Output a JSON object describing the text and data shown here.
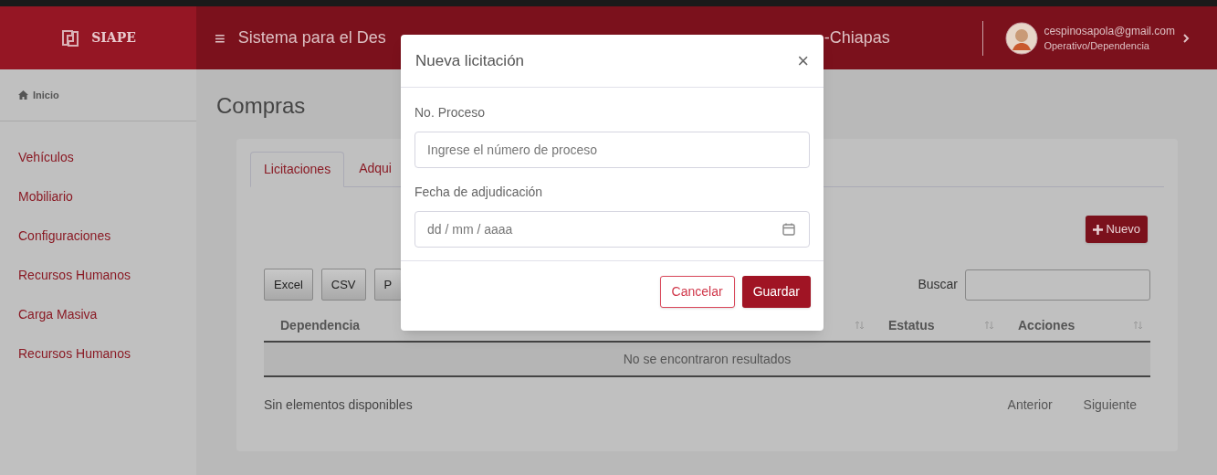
{
  "header": {
    "brand": "SIAPE",
    "menu_glyph": "≡",
    "title_parts": [
      "Sistema para el Des",
      "-Chiapas"
    ],
    "user": {
      "email": "cespinosapola@gmail.com",
      "role": "Operativo/Dependencia"
    }
  },
  "sidebar": {
    "home": "Inicio",
    "items": [
      "Vehículos",
      "Mobiliario",
      "Configuraciones",
      "Recursos Humanos",
      "Carga Masiva",
      "Recursos Humanos"
    ]
  },
  "page_title": "Compras",
  "tabs": [
    {
      "label": "Licitaciones",
      "selected": true
    },
    {
      "label": "Adqui",
      "selected": false
    }
  ],
  "new_button": "Nuevo",
  "export_buttons": [
    "Excel",
    "CSV",
    "P"
  ],
  "search": {
    "label": "Buscar"
  },
  "table": {
    "columns": [
      {
        "label": "Dependencia",
        "sortable": false
      },
      {
        "sortable": true
      },
      {
        "label": "Estatus",
        "sortable": true
      },
      {
        "label": "Acciones",
        "sortable": true
      }
    ],
    "empty_message": "No se encontraron resultados"
  },
  "footer": {
    "info": "Sin elementos disponibles",
    "previous": "Anterior",
    "next": "Siguiente"
  },
  "modal": {
    "title": "Nueva licitación",
    "close_glyph": "×",
    "fields": [
      {
        "kind": "text",
        "label": "No. Proceso",
        "placeholder": "Ingrese el número de proceso"
      },
      {
        "kind": "date",
        "label": "Fecha de adjudicación",
        "placeholder": "dd / mm / aaaa"
      }
    ],
    "buttons": [
      {
        "label": "Cancelar",
        "kind": "outline"
      },
      {
        "label": "Guardar",
        "kind": "primary"
      }
    ]
  }
}
